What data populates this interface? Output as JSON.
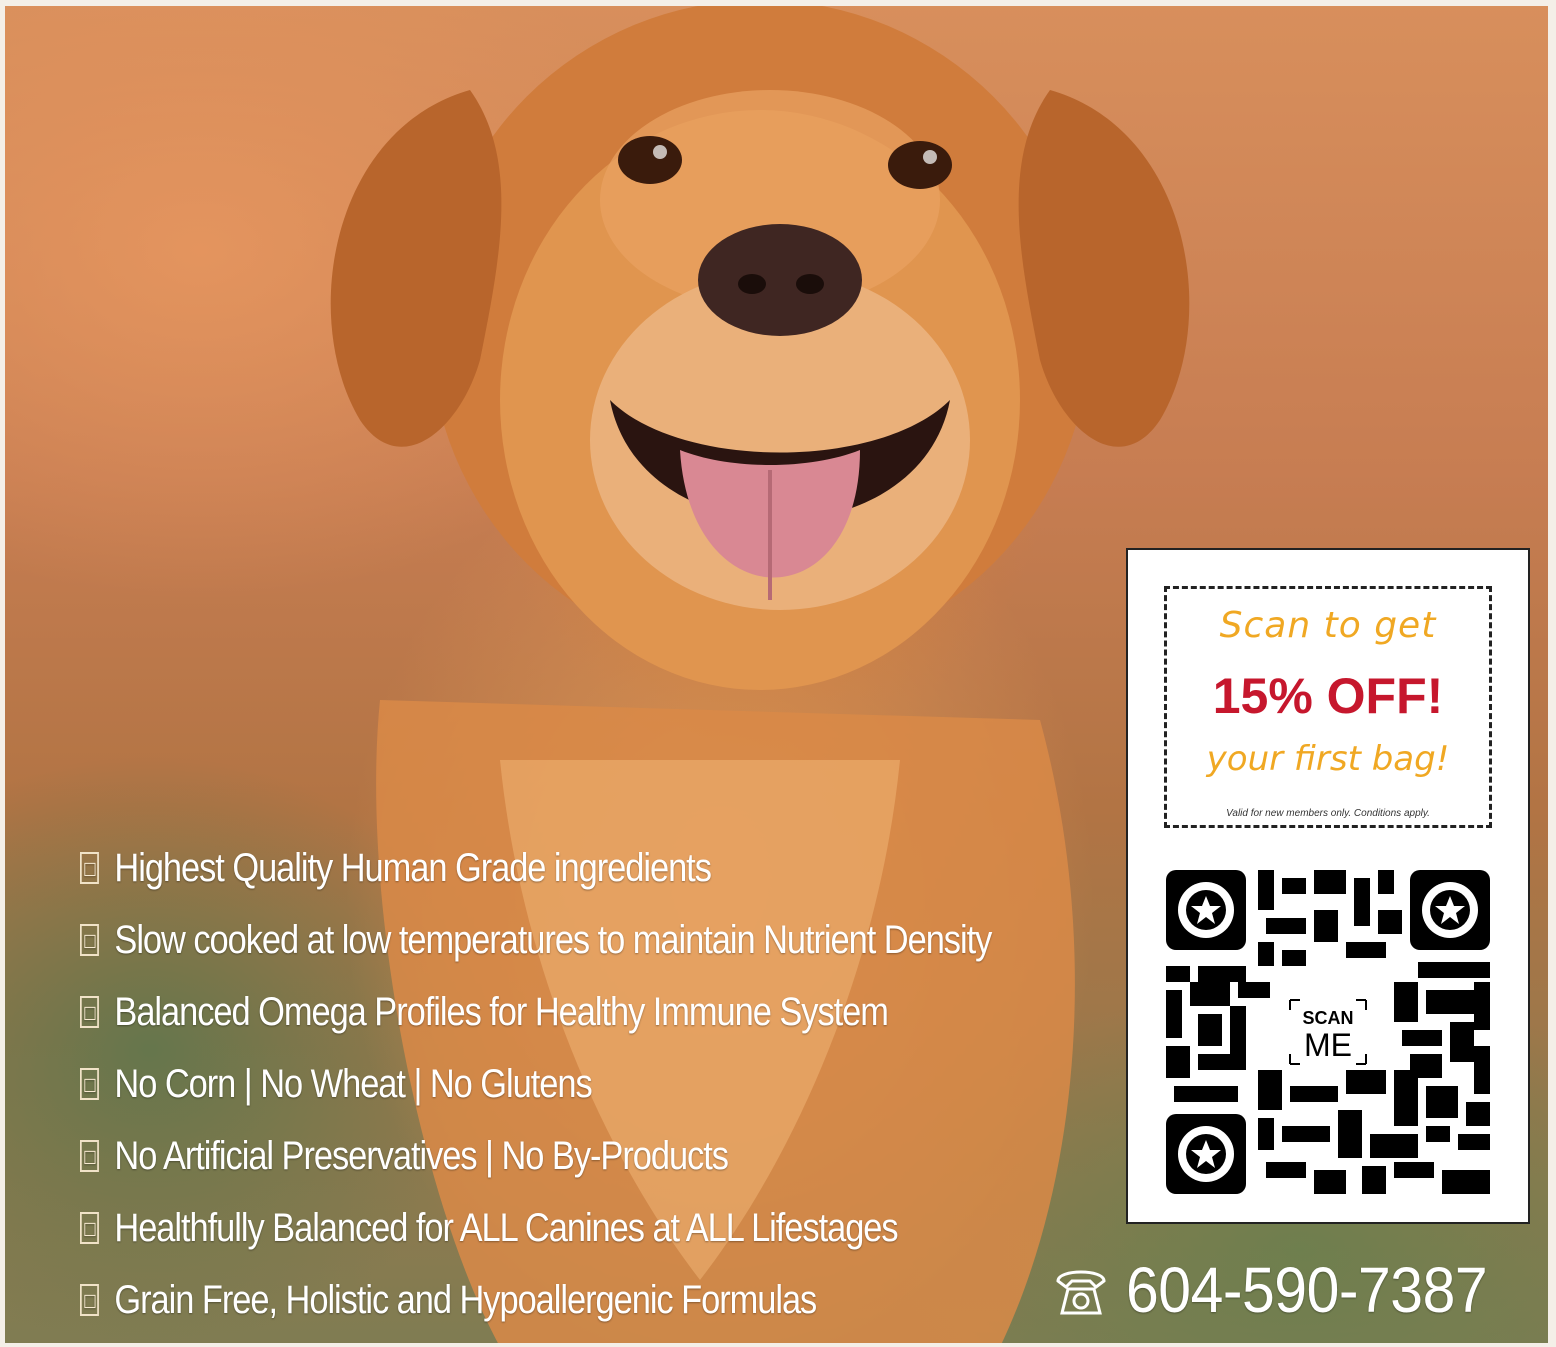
{
  "features": [
    "Highest Quality Human Grade ingredients",
    "Slow cooked at low temperatures to maintain Nutrient Density",
    "Balanced Omega Profiles for Healthy Immune System",
    "No Corn | No Wheat | No Glutens",
    "No Artificial Preservatives | No By-Products",
    "Healthfully Balanced for ALL Canines at ALL Lifestages",
    "Grain Free, Holistic and Hypoallergenic Formulas"
  ],
  "bullet_glyph": "☐",
  "promo": {
    "line1": "Scan to get",
    "line2": "15% OFF!",
    "line3": "your first bag!",
    "fine_print": "Valid for new members only.  Conditions apply.",
    "qr_label_top": "SCAN",
    "qr_label_bottom": "ME"
  },
  "contact": {
    "phone_icon": "telephone-icon",
    "phone": "604-590-7387"
  },
  "colors": {
    "promo_yellow": "#f0a823",
    "promo_red": "#c6172d",
    "text_white": "#ffffff"
  }
}
